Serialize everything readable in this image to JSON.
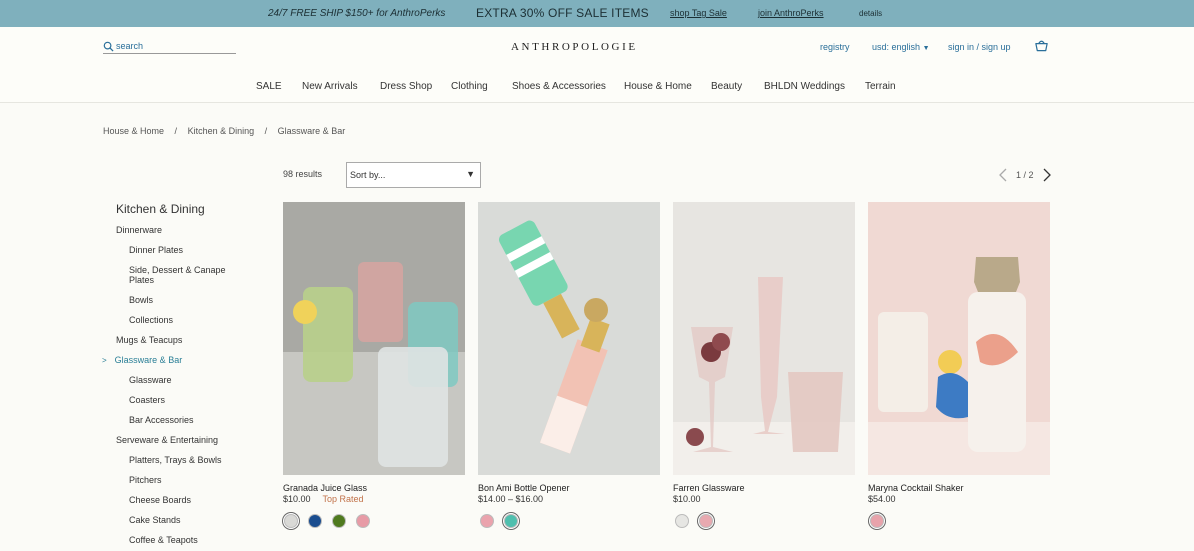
{
  "promo": {
    "ship": "24/7 FREE SHIP $150+ for AnthroPerks",
    "sale": "EXTRA 30% OFF SALE ITEMS",
    "shop_tag": "shop Tag Sale",
    "join": "join AnthroPerks",
    "details": "details"
  },
  "header": {
    "search_placeholder": "search",
    "logo": "ANTHROPOLOGIE",
    "registry": "registry",
    "currency": "usd: english",
    "signin": "sign in / sign up"
  },
  "nav": [
    "SALE",
    "New Arrivals",
    "Dress Shop",
    "Clothing",
    "Shoes & Accessories",
    "House & Home",
    "Beauty",
    "BHLDN Weddings",
    "Terrain"
  ],
  "breadcrumb": [
    "House & Home",
    "/",
    "Kitchen & Dining",
    "/",
    "Glassware & Bar"
  ],
  "sidebar": {
    "heading": "Kitchen & Dining",
    "items": [
      "Dinnerware",
      "Dinner Plates",
      "Side, Dessert & Canape",
      "Plates",
      "Bowls",
      "Collections",
      "Mugs & Teacups",
      "Glassware & Bar",
      "Glassware",
      "Coasters",
      "Bar Accessories",
      "Serveware & Entertaining",
      "Platters, Trays & Bowls",
      "Pitchers",
      "Cheese Boards",
      "Cake Stands",
      "Coffee & Teapots"
    ]
  },
  "toolbar": {
    "results": "98 results",
    "sort": "Sort by...",
    "page": "1 / 2"
  },
  "products": [
    {
      "name": "Granada Juice Glass",
      "price": "$10.00",
      "badge": "Top Rated",
      "swatches": [
        "#d9d9d6",
        "#1a4d8f",
        "#4f7a1e",
        "#e79ba6"
      ]
    },
    {
      "name": "Bon Ami Bottle Opener",
      "price": "$14.00 – $16.00",
      "badge": "",
      "swatches": [
        "#eaa3ad",
        "#4fbfae"
      ]
    },
    {
      "name": "Farren Glassware",
      "price": "$10.00",
      "badge": "",
      "swatches": [
        "#e6e6e3",
        "#e8a9b0"
      ]
    },
    {
      "name": "Maryna Cocktail Shaker",
      "price": "$54.00",
      "badge": "",
      "swatches": [
        "#e8a3ab"
      ]
    }
  ]
}
